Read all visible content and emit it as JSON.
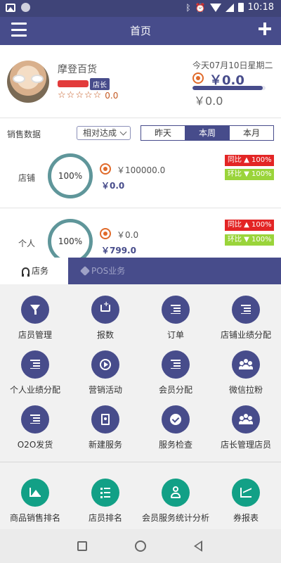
{
  "status_bar": {
    "time": "10:18"
  },
  "header": {
    "title": "首页"
  },
  "profile": {
    "store_name": "摩登百货",
    "role": "店长",
    "stars": [
      "☆",
      "☆",
      "☆",
      "☆",
      "☆"
    ],
    "rating": "0.0",
    "date_text": "今天07月10日星期二",
    "today_amount": "￥0.0",
    "target_amount": "￥0.0",
    "progress": 0.96
  },
  "sales": {
    "label": "销售数据",
    "mode": "相对达成",
    "periods": [
      "昨天",
      "本周",
      "本月"
    ],
    "active_period": "本周"
  },
  "metrics": [
    {
      "label": "店铺",
      "percent": "100%",
      "target": "￥100000.0",
      "actual": "￥0.0",
      "yoy": "同比 ▲ 100%",
      "mom": "环比 ▼ 100%"
    },
    {
      "label": "个人",
      "percent": "100%",
      "target": "￥0.0",
      "actual": "￥799.0",
      "yoy": "同比 ▲ 100%",
      "mom": "环比 ▼ 100%"
    }
  ],
  "tabs": [
    {
      "label": "店务",
      "icon": "headset-icon"
    },
    {
      "label": "POS业务",
      "icon": "cube-icon"
    }
  ],
  "grid_items": [
    {
      "label": "店员管理",
      "icon": "funnel-icon"
    },
    {
      "label": "报数",
      "icon": "cart-icon"
    },
    {
      "label": "订单",
      "icon": "list-icon"
    },
    {
      "label": "店铺业绩分配",
      "icon": "list-icon"
    },
    {
      "label": "个人业绩分配",
      "icon": "list-icon"
    },
    {
      "label": "营销活动",
      "icon": "play-icon"
    },
    {
      "label": "会员分配",
      "icon": "list-icon"
    },
    {
      "label": "微信拉粉",
      "icon": "people-icon"
    },
    {
      "label": "O2O发货",
      "icon": "list-icon"
    },
    {
      "label": "新建服务",
      "icon": "contact-book-icon"
    },
    {
      "label": "服务检查",
      "icon": "check-circle-icon"
    },
    {
      "label": "店长管理店员",
      "icon": "people-icon"
    }
  ],
  "report_items": [
    {
      "label": "商品销售排名",
      "icon": "area-chart-icon"
    },
    {
      "label": "店员排名",
      "icon": "numbered-list-icon"
    },
    {
      "label": "会员服务统计分析",
      "icon": "user-icon"
    },
    {
      "label": "券报表",
      "icon": "trend-chart-icon"
    }
  ],
  "colors": {
    "primary": "#474c8b",
    "teal": "#12a086",
    "orange": "#e06a2a",
    "red": "#e32525",
    "green": "#9ad43a"
  }
}
